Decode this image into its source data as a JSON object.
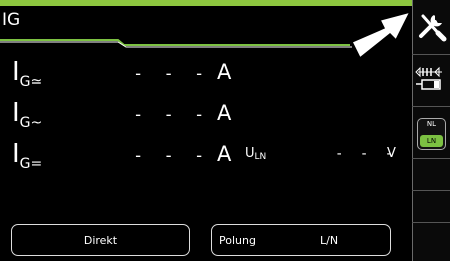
{
  "title": "IG",
  "measurements": [
    {
      "symbol": "I",
      "sub": "G≃",
      "value": "- - -",
      "unit": "A"
    },
    {
      "symbol": "I",
      "sub": "G~",
      "value": "- - -",
      "unit": "A"
    },
    {
      "symbol": "I",
      "sub": "G=",
      "value": "- - -",
      "unit": "A"
    }
  ],
  "uln": {
    "symbol": "U",
    "sub": "LN",
    "value": "- - -",
    "unit": "V"
  },
  "buttons": {
    "direkt": "Direkt",
    "polung_label": "Polung",
    "polung_value": "L/N"
  },
  "sidebar": {
    "nl": "NL",
    "ln": "LN",
    "icons": [
      "tools-icon",
      "setup-icon",
      "nl-ln-toggle"
    ]
  },
  "colors": {
    "accent": "#8dc63f",
    "toggle_active": "#7cc142",
    "background": "#000000"
  }
}
